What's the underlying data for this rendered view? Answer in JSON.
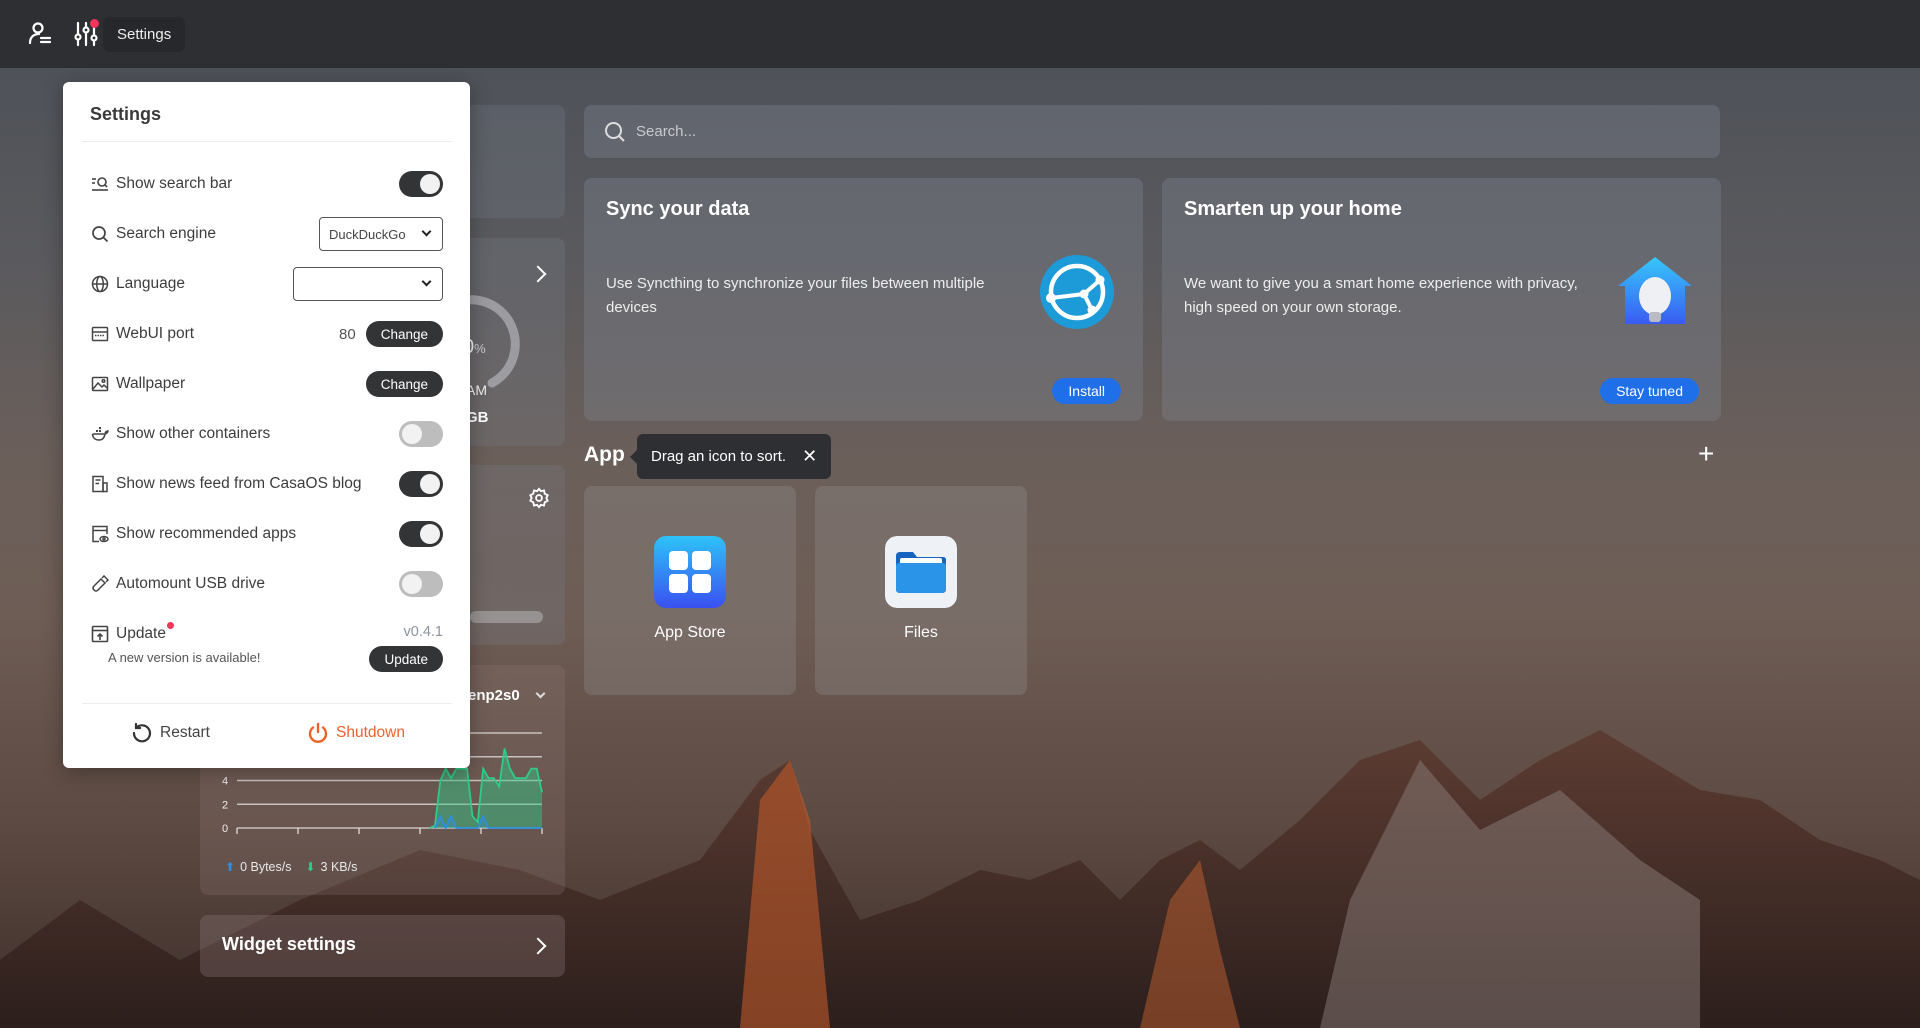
{
  "topbar": {
    "user_icon": "user-list-icon",
    "settings_icon": "sliders-icon",
    "settings_tooltip": "Settings",
    "has_notification": true
  },
  "settings_panel": {
    "title": "Settings",
    "rows": [
      {
        "icon": "search-bar-icon",
        "label": "Show search bar",
        "control": "toggle",
        "value": true
      },
      {
        "icon": "search-icon",
        "label": "Search engine",
        "control": "select",
        "value": "DuckDuckGo"
      },
      {
        "icon": "globe-icon",
        "label": "Language",
        "control": "select",
        "value": ""
      },
      {
        "icon": "port-icon",
        "label": "WebUI port",
        "control": "button",
        "value": "80",
        "button_label": "Change"
      },
      {
        "icon": "image-icon",
        "label": "Wallpaper",
        "control": "button",
        "button_label": "Change"
      },
      {
        "icon": "docker-icon",
        "label": "Show other containers",
        "control": "toggle",
        "value": false
      },
      {
        "icon": "news-icon",
        "label": "Show news feed from CasaOS blog",
        "control": "toggle",
        "value": true
      },
      {
        "icon": "app-eye-icon",
        "label": "Show recommended apps",
        "control": "toggle",
        "value": true
      },
      {
        "icon": "usb-icon",
        "label": "Automount USB drive",
        "control": "toggle",
        "value": false
      }
    ],
    "update": {
      "label": "Update",
      "version": "v0.4.1",
      "message": "A new version is available!",
      "button_label": "Update",
      "has_notification": true
    },
    "restart_label": "Restart",
    "shutdown_label": "Shutdown"
  },
  "widgets": {
    "system": {
      "gauge_value": "0",
      "gauge_unit": "%",
      "ram_label": "AM",
      "ram_size": "GB"
    },
    "network": {
      "interface": "enp2s0",
      "upload": "0 Bytes/s",
      "download": "3 KB/s",
      "y_ticks": [
        "0",
        "2",
        "4"
      ]
    },
    "widget_settings_label": "Widget settings"
  },
  "search": {
    "placeholder": "Search..."
  },
  "recommendations": [
    {
      "title": "Sync your data",
      "description": "Use Syncthing to synchronize your files between multiple devices",
      "button": "Install",
      "icon": "syncthing-icon"
    },
    {
      "title": "Smarten up your home",
      "description": "We want to give you a smart home experience with privacy, high speed on your own storage.",
      "button": "Stay tuned",
      "icon": "smart-home-icon"
    }
  ],
  "apps": {
    "section_title": "App",
    "tip": "Drag an icon to sort.",
    "items": [
      {
        "name": "App Store",
        "icon": "app-store-icon"
      },
      {
        "name": "Files",
        "icon": "files-icon"
      }
    ]
  },
  "colors": {
    "accent_blue": "#1f6fe9",
    "shutdown_orange": "#f0622a",
    "notify_red": "#f0365a",
    "download_green": "#2ecc8a",
    "upload_blue": "#2e8fe0"
  },
  "chart_data": {
    "type": "area",
    "title": "",
    "xlabel": "",
    "ylabel": "",
    "ylim": [
      0,
      8
    ],
    "y_ticks": [
      0,
      2,
      4,
      6,
      8
    ],
    "y_tick_labels_visible": [
      "0",
      "2",
      "4"
    ],
    "legend": [
      "Upload",
      "Download"
    ],
    "series": [
      {
        "name": "Download",
        "color": "#2ecc8a",
        "values": [
          0,
          0,
          0,
          0,
          0,
          0,
          0,
          0,
          0,
          0,
          0,
          0,
          0,
          0,
          0,
          0,
          0,
          0,
          0,
          0,
          0,
          0,
          0,
          0,
          0,
          0,
          0,
          0,
          0,
          0,
          0,
          0,
          0,
          0,
          0,
          0,
          0,
          0.2,
          4,
          5,
          4.2,
          5,
          5,
          5,
          1,
          0.5,
          5,
          4.2,
          4.2,
          3.5,
          6.7,
          5,
          4.2,
          4.2,
          4.2,
          5,
          5,
          3
        ]
      },
      {
        "name": "Upload",
        "color": "#2e8fe0",
        "values": [
          0,
          0,
          0,
          0,
          0,
          0,
          0,
          0,
          0,
          0,
          0,
          0,
          0,
          0,
          0,
          0,
          0,
          0,
          0,
          0,
          0,
          0,
          0,
          0,
          0,
          0,
          0,
          0,
          0,
          0,
          0,
          0,
          0,
          0,
          0,
          0,
          0,
          0,
          1,
          0,
          1,
          0,
          0,
          0,
          0,
          0,
          1,
          0,
          0,
          0,
          0,
          0,
          0,
          0,
          0,
          0,
          0,
          0
        ]
      }
    ]
  }
}
